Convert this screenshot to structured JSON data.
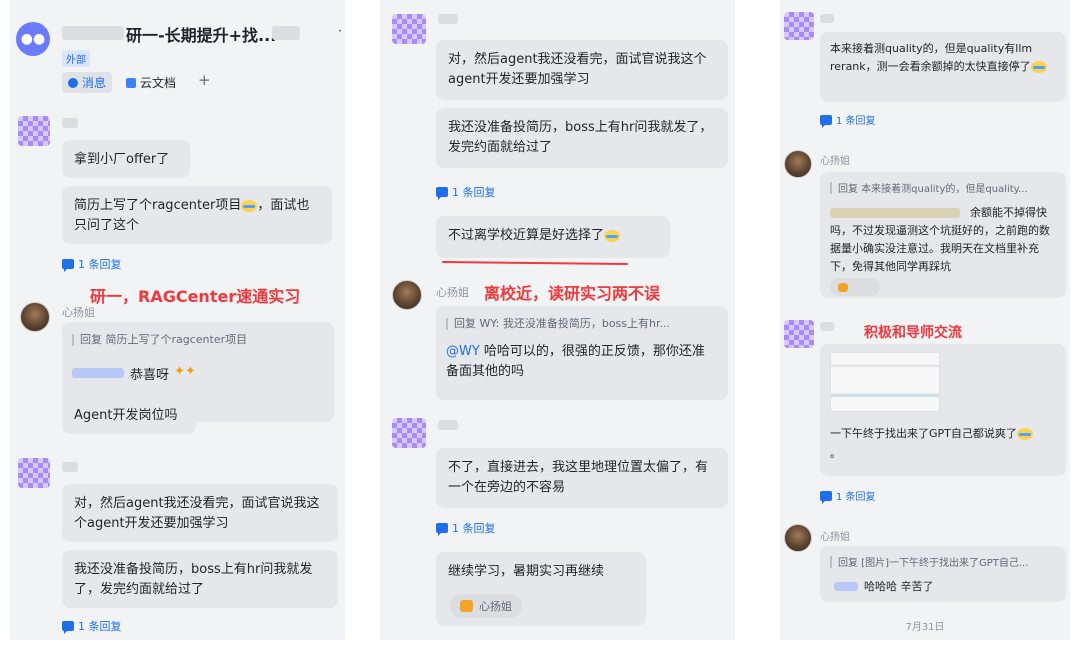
{
  "colors": {
    "accent": "#1f6feb",
    "annotation": "#f0393c",
    "bubble": "#e6e7ea"
  },
  "panel1": {
    "group_title": "研一-长期提升+找...",
    "external_tag": "外部",
    "tabs": {
      "messages": "消息",
      "docs": "云文档",
      "add": "+"
    },
    "msg1": "拿到小厂offer了",
    "msg2": "简历上写了个ragcenter项目",
    "msg2b": "，面试也只问了这个",
    "reply_count": "1 条回复",
    "annotation": "研一，RAGCenter速通实习",
    "sender": "心扬姐",
    "quote": "回复      简历上写了个ragcenter项目",
    "congrats": "恭喜呀",
    "agent_q": "Agent开发岗位吗",
    "msg3": "对，然后agent我还没看完，面试官说我这个agent开发还要加强学习",
    "msg4": "我还没准备投简历，boss上有hr问我就发了，发完约面就给过了",
    "reply_count2": "1 条回复"
  },
  "panel2": {
    "msg1": "对，然后agent我还没看完，面试官说我这个agent开发还要加强学习",
    "msg2": "我还没准备投简历，boss上有hr问我就发了，发完约面就给过了",
    "reply_count": "1 条回复",
    "msg3": "不过离学校近算是好选择了",
    "sender": "心扬姐",
    "annotation": "离校近，读研实习两不误",
    "quote": "回复 WY: 我还没准备投简历，boss上有hr...",
    "mention": "@WY",
    "reply_text": " 哈哈可以的，很强的正反馈，那你还准备面其他的吗",
    "msg4": "不了，直接进去，我这里地理位置太偏了，有一个在旁边的不容易",
    "reply_count2": "1 条回复",
    "msg5": "继续学习，暑期实习再继续",
    "reaction_user": "心扬姐"
  },
  "panel3": {
    "msg1": "本来接着测quality的，但是quality有llm rerank，测一会看余额掉的太快直接停了",
    "reply_count": "1 条回复",
    "sender": "心扬姐",
    "quote": "回复      本来接着测quality的，但是quality...",
    "reply_text": "余额能不掉得快吗，不过发现逼测这个坑挺好的，之前跑的数据量小确实没注意过。我明天在文档里补充下，免得其他同学再踩坑",
    "annotation": "积极和导师交流",
    "msg2": "一下午终于找出来了GPT自己都说爽了",
    "msg2_dot": "。",
    "reply_count2": "1 条回复",
    "sender2": "心扬姐",
    "quote2": "回复      [图片]一下午终于找出来了GPT自己...",
    "reply2": "哈哈哈 辛苦了",
    "date": "7月31日"
  }
}
